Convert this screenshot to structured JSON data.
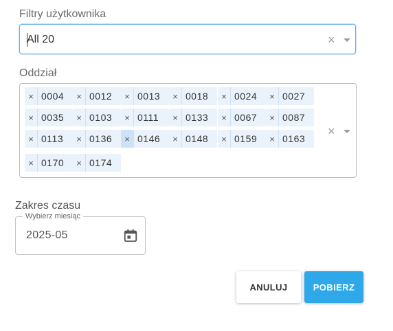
{
  "user_filter": {
    "label": "Filtry użytkownika",
    "value": "All 20",
    "clear_glyph": "×"
  },
  "branch": {
    "label": "Oddział",
    "remove_glyph": "×",
    "clear_glyph": "×",
    "tags": [
      "0004",
      "0012",
      "0013",
      "0018",
      "0024",
      "0027",
      "0035",
      "0103",
      "0111",
      "0133",
      "0067",
      "0087",
      "0113",
      "0136",
      "0146",
      "0148",
      "0159",
      "0163",
      "0170",
      "0174"
    ]
  },
  "time_range": {
    "label": "Zakres czasu",
    "month_legend": "Wybierz miesiąc",
    "month_value": "2025-05",
    "icon": "calendar-icon"
  },
  "actions": {
    "cancel_label": "ANULUJ",
    "download_label": "POBIERZ"
  },
  "colors": {
    "accent": "#2ea8e8",
    "focus_border": "#66afe9",
    "tag_bg": "#eaf3fc"
  }
}
